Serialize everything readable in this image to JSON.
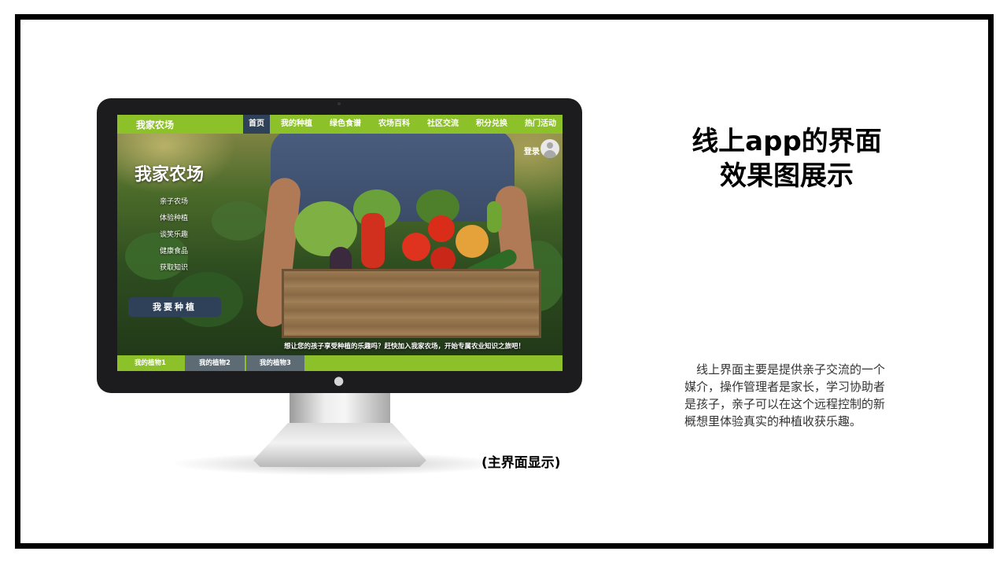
{
  "app": {
    "brand": "我家农场",
    "nav": [
      "首页",
      "我的种植",
      "绿色食谱",
      "农场百科",
      "社区交流",
      "积分兑换",
      "热门活动"
    ],
    "active_nav": "首页",
    "login_label": "登录",
    "hero_title": "我家农场",
    "side_menu": [
      "亲子农场",
      "体验种植",
      "谈笑乐趣",
      "健康食品",
      "获取知识"
    ],
    "cta_label": "我要种植",
    "slogan": "想让您的孩子享受种植的乐趣吗？赶快加入我家农场，开始专属农业知识之旅吧！",
    "tabs": [
      "我的植物1",
      "我的植物2",
      "我的植物3"
    ]
  },
  "slide": {
    "title_line1": "线上app的界面",
    "title_line2": "效果图展示",
    "description": "　线上界面主要是提供亲子交流的一个媒介，操作管理者是家长，学习协助者是孩子，亲子可以在这个远程控制的新概想里体验真实的种植收获乐趣。",
    "caption": "(主界面显示)"
  },
  "colors": {
    "nav_green": "#8dc12a",
    "nav_active": "#2f4159",
    "monitor_bezel": "#1c1c1e"
  }
}
